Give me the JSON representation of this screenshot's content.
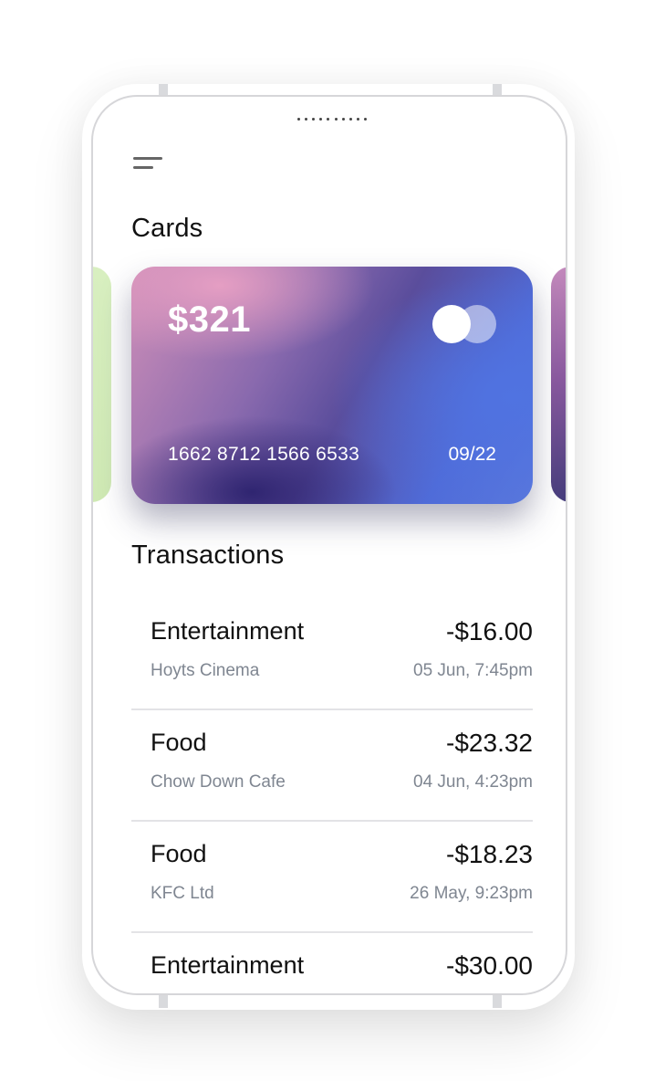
{
  "header": {
    "menu_icon": "hamburger-menu-icon"
  },
  "cards_section": {
    "title": "Cards",
    "card": {
      "balance": "$321",
      "number": "1662 8712 1566 6533",
      "expiry": "09/22",
      "network_icon": "card-network-logo-icon"
    },
    "peek_left_color": "#d8efc0",
    "peek_right_color": "#8b5aa0"
  },
  "transactions_section": {
    "title": "Transactions",
    "items": [
      {
        "category": "Entertainment",
        "merchant": "Hoyts Cinema",
        "amount": "-$16.00",
        "date": "05 Jun, 7:45pm"
      },
      {
        "category": "Food",
        "merchant": "Chow Down Cafe",
        "amount": "-$23.32",
        "date": "04 Jun, 4:23pm"
      },
      {
        "category": "Food",
        "merchant": "KFC Ltd",
        "amount": "-$18.23",
        "date": "26 May, 9:23pm"
      },
      {
        "category": "Entertainment",
        "merchant": "",
        "amount": "-$30.00",
        "date": ""
      }
    ]
  },
  "colors": {
    "text_primary": "#111111",
    "text_secondary": "#7f8691",
    "divider": "#e3e3e6",
    "card_gradient_start": "#cf8fb8",
    "card_gradient_end": "#5a78dc"
  }
}
